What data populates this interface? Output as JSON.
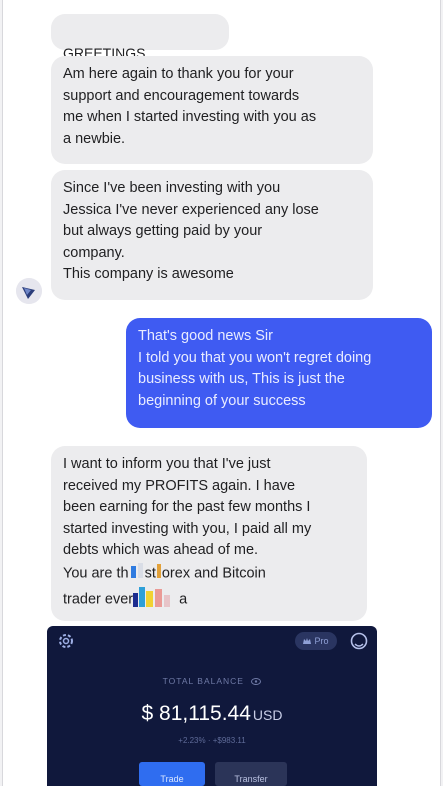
{
  "messages": {
    "greeting": "GREETINGS",
    "thanks": "Am here again to thank you for your\nsupport and encouragement towards\nme when I started investing with you as\na newbie.",
    "investing": "Since I've been investing with you\nJessica I've never experienced any lose\nbut always getting paid by your\ncompany.\nThis company is awesome",
    "reply": "That's good news Sir\nI told you that you won't regret doing\nbusiness with us, This is just the\nbeginning of your success",
    "profit_text": "I want to inform you that I've just\nreceived my PROFITS again. I have\nbeen earning for the past few months I\nstarted investing with you, I paid all my\ndebts which was ahead of me.\nYou are th",
    "profit_mid": "st",
    "profit_mid2": "orex and Bitcoin",
    "profit_end_a": "trader ever",
    "profit_end_b": "a"
  },
  "app_card": {
    "pill_label": "Pro",
    "balance_label": "TOTAL BALANCE",
    "balance_value": "$ 81,115.44",
    "currency": "USD",
    "change": "+2.23%  ·  +$983.11",
    "trade_label": "Trade",
    "transfer_label": "Transfer"
  },
  "colors": {
    "incoming_bubble": "#ececee",
    "outgoing_bubble": "#3f5bf2",
    "card_bg": "#10183c",
    "trade_button": "#2f6df0"
  }
}
